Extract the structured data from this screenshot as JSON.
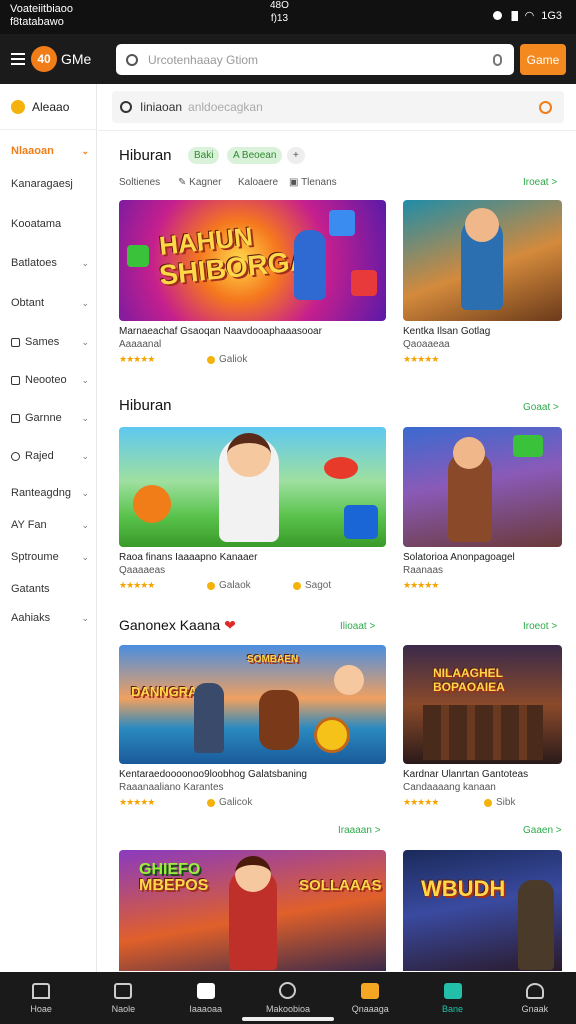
{
  "status_bar": {
    "left_line1": "Voateiitbiaoo",
    "left_line2": "f8tatabawo",
    "center_line1": "48O",
    "center_line2": "f)13",
    "right_text": "1G3"
  },
  "app_bar": {
    "logo_text": "40",
    "brand": "GMe",
    "search_placeholder": "Urcotenhaaay Gtiom",
    "button_label": "Game"
  },
  "sidebar": {
    "header": "Aleaao",
    "items": [
      {
        "label": "Nlaaoan",
        "icon": "",
        "chevron": true,
        "active": true
      },
      {
        "label": "Kanaragaesj",
        "icon": "",
        "chevron": false
      },
      {
        "label": "Kooatama",
        "icon": "",
        "chevron": false
      },
      {
        "label": "Batlatoes",
        "icon": "",
        "chevron": true
      },
      {
        "label": "Obtant",
        "icon": "",
        "chevron": true
      },
      {
        "label": "Sames",
        "icon": "square-icon",
        "chevron": true
      },
      {
        "label": "Neooteo",
        "icon": "square-icon",
        "chevron": true
      },
      {
        "label": "Garnne",
        "icon": "square-icon",
        "chevron": true
      },
      {
        "label": "Rajed",
        "icon": "circle-icon",
        "chevron": true
      },
      {
        "label": "Ranteagdng",
        "icon": "",
        "chevron": true
      },
      {
        "label": "AY Fan",
        "icon": "",
        "chevron": true
      },
      {
        "label": "Sptroume",
        "icon": "",
        "chevron": true
      },
      {
        "label": "Gatants",
        "icon": "",
        "chevron": false
      },
      {
        "label": "Aahiaks",
        "icon": "",
        "chevron": true
      }
    ]
  },
  "main_search": {
    "query": "Iiniaoan",
    "hint": "anldoecagkan"
  },
  "section1": {
    "title": "Hiburan",
    "chips": [
      "Baki",
      "A Beoean",
      "+"
    ],
    "filters": [
      "Soltienes",
      "Kagner",
      "Kaloaere",
      "Tlenans"
    ],
    "more": "Iroeat >"
  },
  "cards_row1": [
    {
      "art_title_1": "HAHUN",
      "art_title_2": "SHIBORGA",
      "caption": "Marnaeachaf Gsaoqan Naavdooaphaaasooar",
      "sub": "Aaaaanal",
      "stars": "★★★★★",
      "coin": "Galiok"
    },
    {
      "caption": "Kentka Ilsan Gotlag",
      "sub": "Qaoaaeaa",
      "stars": "★★★★★"
    }
  ],
  "section2": {
    "title": "Hiburan",
    "more": "Goaat >"
  },
  "cards_row2": [
    {
      "caption": "Raoa finans Iaaaapno Kanaaer",
      "sub": "Qaaaaeas",
      "stars": "★★★★★",
      "coin": "Galaok",
      "coin2": "Sagot"
    },
    {
      "caption": "Solatorioa Anonpagoagel",
      "sub": "Raanaas",
      "stars": "★★★★★"
    }
  ],
  "section3": {
    "title": "Ganonex Kaana",
    "more": "Ilioaat >",
    "more2": "Iroeot >"
  },
  "cards_row3": [
    {
      "art_title": "DANNGRAN",
      "art_title_2": "SOMBAEN",
      "caption": "Kentaraedoooonoo9loobhog Galatsbaning",
      "sub": "Raaanaaliano Karantes",
      "stars": "★★★★★",
      "coin": "Galicok"
    },
    {
      "art_title": "NILAAGHEL",
      "art_title_2": "BOPAOAIEA",
      "caption": "Kardnar Ulanrtan Gantoteas",
      "sub": "Candaaaang kanaan",
      "stars": "★★★★★",
      "coin": "Sibk"
    }
  ],
  "section4": {
    "more": "Iraaaan >",
    "more2": "Gaaen >"
  },
  "cards_row4": [
    {
      "art_title": "GHIEFO",
      "art_title_2": "MBEPOS",
      "art_title_3": "SOLLAAAS"
    },
    {
      "art_title": "WBUDH"
    }
  ],
  "bottom_nav": [
    {
      "label": "Hoae",
      "icon": "home-icon"
    },
    {
      "label": "Naole",
      "icon": "book-icon"
    },
    {
      "label": "Iaaaoaa",
      "icon": "inbox-icon"
    },
    {
      "label": "Makoobioa",
      "icon": "clock-icon"
    },
    {
      "label": "Qnaaaga",
      "icon": "grid-icon"
    },
    {
      "label": "Bane",
      "icon": "game-icon",
      "active": true
    },
    {
      "label": "Gnaak",
      "icon": "profile-icon"
    }
  ],
  "colors": {
    "accent": "#f07d18",
    "green": "#2eaa4a",
    "teal": "#22c0a8",
    "dark": "#1b1b1b"
  }
}
